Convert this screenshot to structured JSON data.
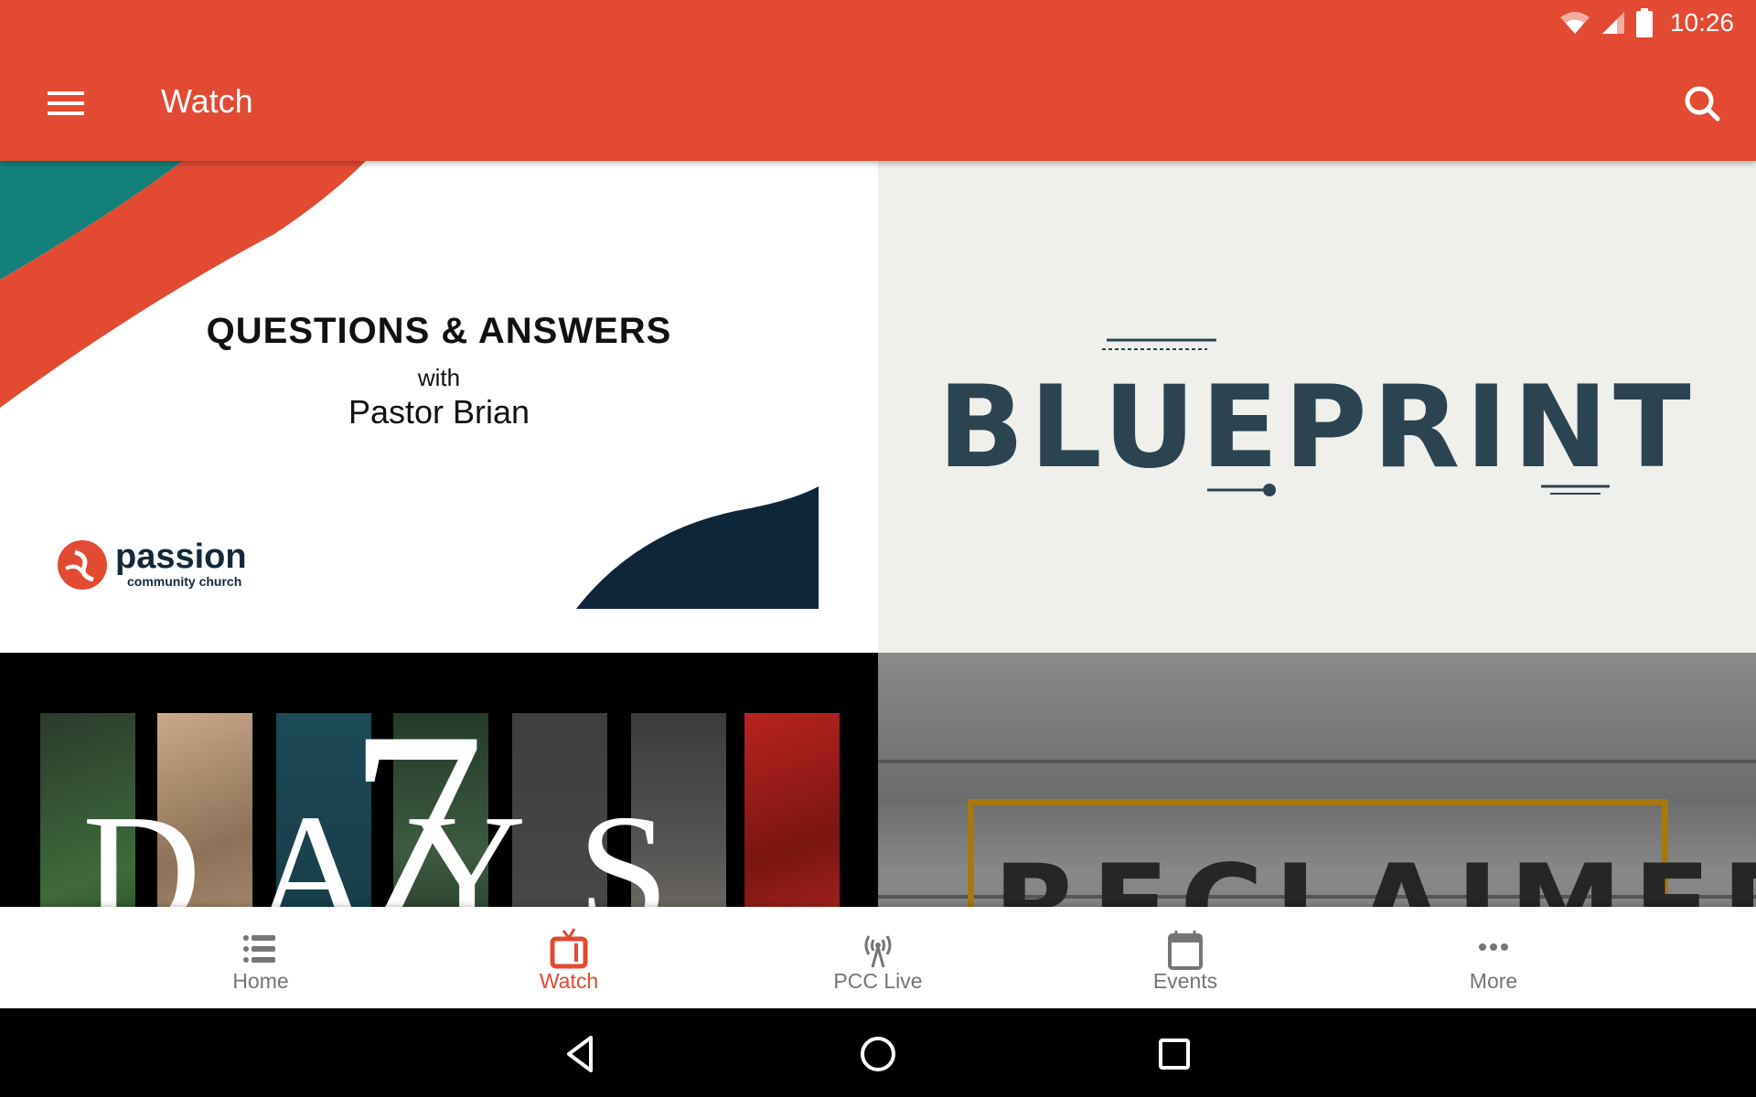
{
  "status_bar": {
    "time": "10:26",
    "icons": [
      "wifi-icon",
      "cellular-signal-icon",
      "battery-icon"
    ]
  },
  "toolbar": {
    "title": "Watch",
    "menu_icon": "hamburger-menu-icon",
    "search_icon": "search-icon",
    "background_color": "#e24a32"
  },
  "series": [
    {
      "title": "QUESTIONS & ANSWERS",
      "subtitle_with": "with",
      "subtitle_name": "Pastor Brian",
      "logo_name": "passion",
      "logo_tagline": "community church"
    },
    {
      "title": "BLUEPRINT"
    },
    {
      "title_number": "7",
      "title_word": "DAYS"
    },
    {
      "title": "RECLAIMED"
    }
  ],
  "bottom_nav": {
    "items": [
      {
        "label": "Home",
        "icon": "list-icon",
        "active": false
      },
      {
        "label": "Watch",
        "icon": "tv-icon",
        "active": true
      },
      {
        "label": "PCC Live",
        "icon": "broadcast-tower-icon",
        "active": false
      },
      {
        "label": "Events",
        "icon": "calendar-icon",
        "active": false
      },
      {
        "label": "More",
        "icon": "more-horizontal-icon",
        "active": false
      }
    ],
    "active_color": "#e24a32",
    "inactive_color": "#757575"
  },
  "system_nav": {
    "buttons": [
      "back-icon",
      "home-circle-icon",
      "recents-square-icon"
    ]
  }
}
